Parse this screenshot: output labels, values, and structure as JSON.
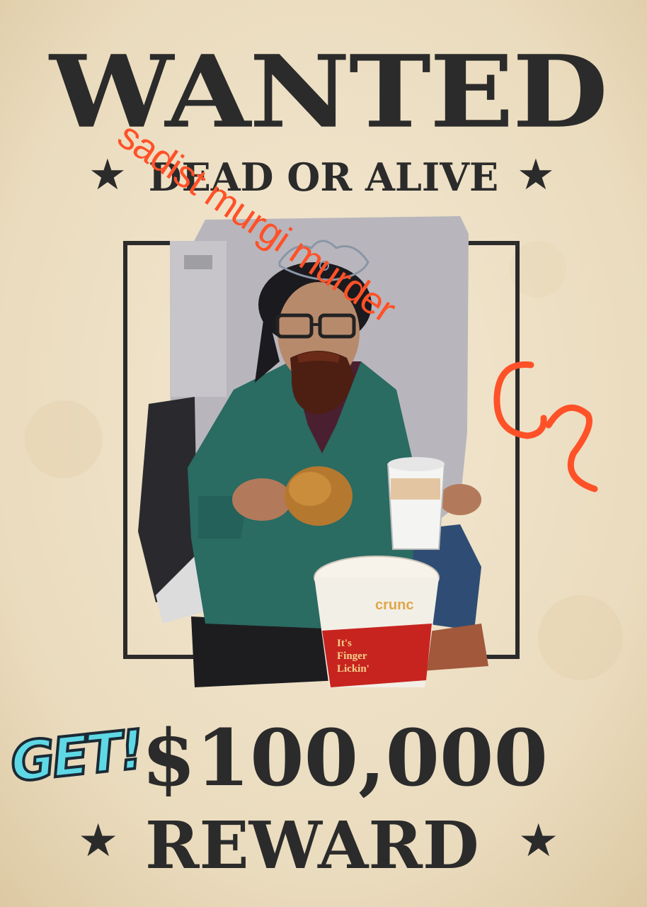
{
  "poster": {
    "title": "WANTED",
    "subtitle": "DEAD OR ALIVE",
    "amount": "$100,000",
    "reward_label": "REWARD",
    "star_glyph": "★"
  },
  "stickers": {
    "get_label": "GET!",
    "scribble_text": "sadist murgi murder",
    "scribble_color": "#ff5128",
    "bucket_brand": "crunc",
    "bucket_slogan_line1": "It's",
    "bucket_slogan_line2": "Finger",
    "bucket_slogan_line3": "Lickin'"
  },
  "colors": {
    "paper": "#efe2c8",
    "ink": "#2b2b2b",
    "jacket": "#2a6b62",
    "badge": "#5fd8e6"
  }
}
